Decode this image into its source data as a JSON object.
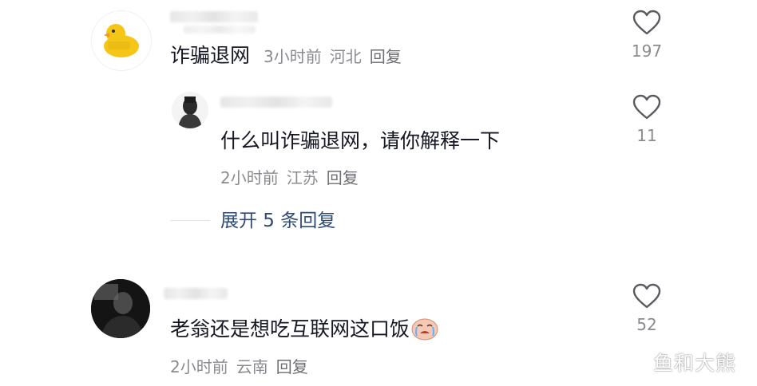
{
  "comments": [
    {
      "text": "诈骗退网",
      "time": "3小时前",
      "location": "河北",
      "reply_label": "回复",
      "likes": "197"
    },
    {
      "text": "什么叫诈骗退网，请你解释一下",
      "time": "2小时前",
      "location": "江苏",
      "reply_label": "回复",
      "likes": "11",
      "expand_label": "展开 5 条回复"
    },
    {
      "text": "老翁还是想吃互联网这口饭",
      "emoji": "crying-face-emoji",
      "time": "2小时前",
      "location": "云南",
      "reply_label": "回复",
      "likes": "52"
    }
  ],
  "watermark": "鱼和大熊",
  "colors": {
    "meta_gray": "#8a8b91",
    "expand_blue": "#2f4a73",
    "duck_yellow": "#f5c518"
  }
}
